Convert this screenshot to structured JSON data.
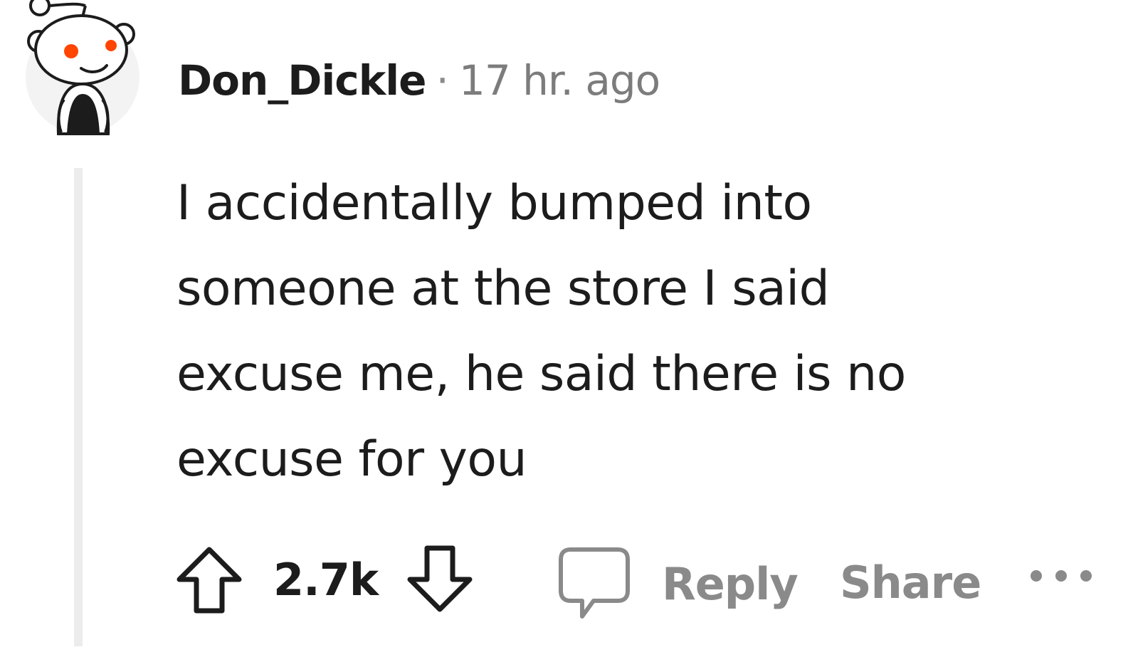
{
  "comment": {
    "author": "Don_Dickle",
    "separator": "·",
    "timestamp": "17 hr. ago",
    "body_lines": [
      "I accidentally bumped into",
      "someone at the store I said",
      "excuse me, he said there is no",
      "excuse for you"
    ]
  },
  "actions": {
    "vote_count": "2.7k",
    "reply_label": "Reply",
    "share_label": "Share"
  },
  "icons": {
    "avatar": "reddit-snoo-avatar-icon",
    "upvote": "upvote-arrow-icon",
    "downvote": "downvote-arrow-icon",
    "reply": "comment-bubble-icon",
    "more": "more-options-icon"
  },
  "colors": {
    "text": "#1c1c1c",
    "muted": "#8a8a8a",
    "thread_line": "#ececec",
    "avatar_eye": "#ff4500"
  }
}
